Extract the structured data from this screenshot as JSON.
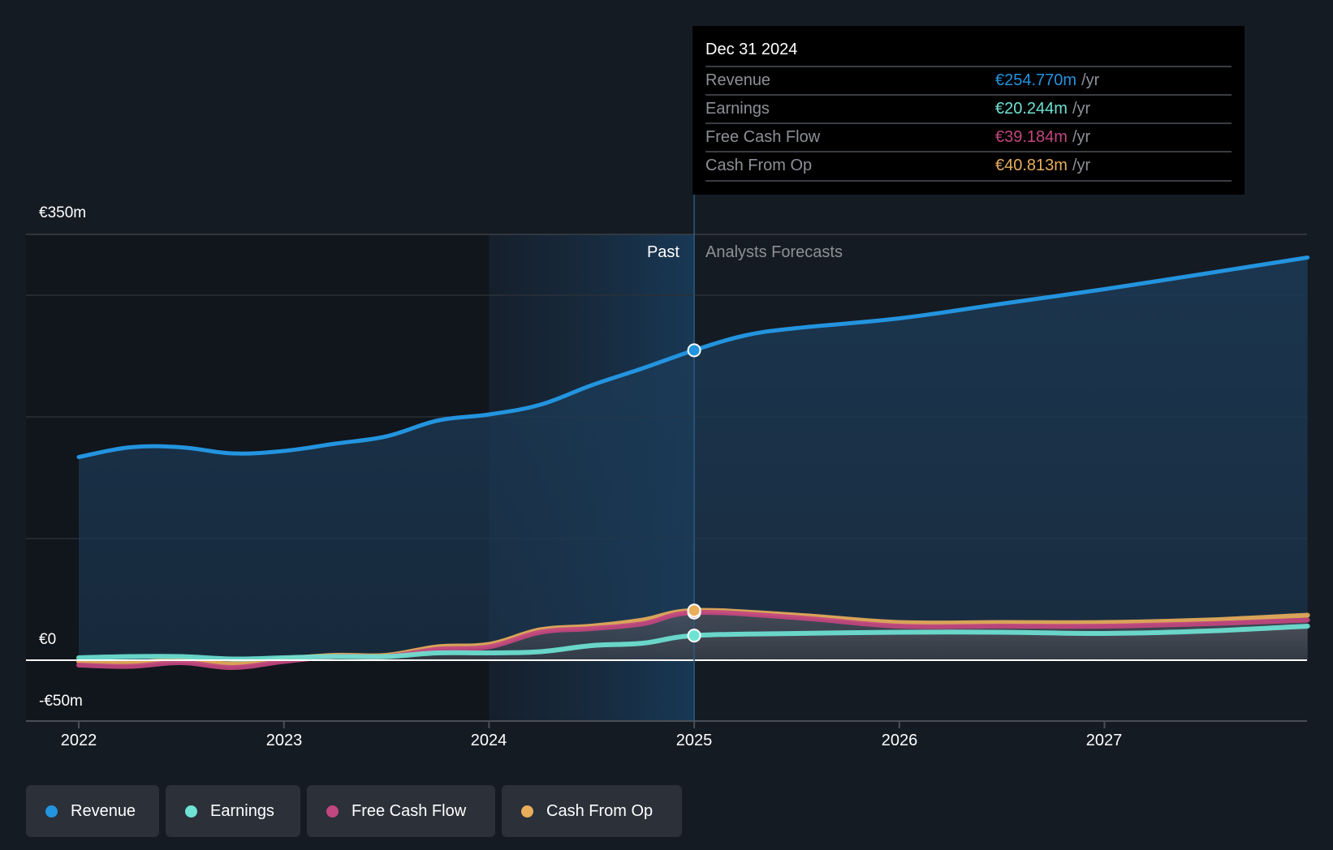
{
  "chart_data": {
    "type": "area",
    "title": "",
    "xlabel": "",
    "ylabel": "",
    "ylim": [
      -50,
      350
    ],
    "xlim": [
      2021.75,
      2027.99
    ],
    "y_ticks": [
      {
        "value": 350,
        "label": "€350m"
      },
      {
        "value": 0,
        "label": "€0"
      },
      {
        "value": -50,
        "label": "-€50m"
      }
    ],
    "gridlines": [
      350,
      300,
      200,
      100
    ],
    "x_ticks": [
      {
        "value": 2022,
        "label": "2022"
      },
      {
        "value": 2023,
        "label": "2023"
      },
      {
        "value": 2024,
        "label": "2024"
      },
      {
        "value": 2025,
        "label": "2025"
      },
      {
        "value": 2026,
        "label": "2026"
      },
      {
        "value": 2027,
        "label": "2027"
      }
    ],
    "past_forecast_split": 2025,
    "highlight_band_start": 2024,
    "region_labels": {
      "past": "Past",
      "forecast": "Analysts Forecasts"
    },
    "series": [
      {
        "name": "Revenue",
        "color": "#2394df",
        "x": [
          2022.0,
          2022.25,
          2022.5,
          2022.75,
          2023.0,
          2023.25,
          2023.5,
          2023.75,
          2024.0,
          2024.25,
          2024.5,
          2024.75,
          2025.0,
          2025.25,
          2025.5,
          2026.0,
          2026.5,
          2027.0,
          2027.5,
          2027.99
        ],
        "values": [
          167,
          175,
          175,
          170,
          172,
          178,
          184,
          197,
          202,
          210,
          226,
          240,
          254.77,
          267,
          273,
          281,
          293,
          305,
          318,
          331
        ]
      },
      {
        "name": "Earnings",
        "color": "#6ee3d4",
        "x": [
          2022.0,
          2022.25,
          2022.5,
          2022.75,
          2023.0,
          2023.25,
          2023.5,
          2023.75,
          2024.0,
          2024.25,
          2024.5,
          2024.75,
          2025.0,
          2025.5,
          2026.0,
          2026.5,
          2027.0,
          2027.5,
          2027.99
        ],
        "values": [
          2,
          3,
          3,
          1,
          2,
          3,
          3,
          6,
          6,
          7,
          12,
          14,
          20.244,
          22,
          23,
          23,
          22,
          24,
          28
        ]
      },
      {
        "name": "Free Cash Flow",
        "color": "#c2467f",
        "x": [
          2022.0,
          2022.25,
          2022.5,
          2022.75,
          2023.0,
          2023.25,
          2023.5,
          2023.75,
          2024.0,
          2024.25,
          2024.5,
          2024.75,
          2025.0,
          2025.5,
          2026.0,
          2026.5,
          2027.0,
          2027.5,
          2027.99
        ],
        "values": [
          -4,
          -5,
          -2,
          -6,
          -1,
          3,
          3,
          9,
          11,
          23,
          26,
          30,
          39.184,
          35,
          28,
          28,
          28,
          30,
          33
        ]
      },
      {
        "name": "Cash From Op",
        "color": "#e8ae5b",
        "x": [
          2022.0,
          2022.25,
          2022.5,
          2022.75,
          2023.0,
          2023.25,
          2023.5,
          2023.75,
          2024.0,
          2024.25,
          2024.5,
          2024.75,
          2025.0,
          2025.5,
          2026.0,
          2026.5,
          2027.0,
          2027.5,
          2027.99
        ],
        "values": [
          -1,
          -2,
          0,
          -3,
          1,
          4,
          4,
          11,
          13,
          25,
          28,
          33,
          40.813,
          37,
          31,
          31,
          31,
          33,
          37
        ]
      }
    ],
    "legend": {
      "placement": "bottom-left"
    }
  },
  "tooltip": {
    "date": "Dec 31 2024",
    "unit": "/yr",
    "rows": [
      {
        "label": "Revenue",
        "value": "€254.770m",
        "color": "#2394df"
      },
      {
        "label": "Earnings",
        "value": "€20.244m",
        "color": "#6ee3d4"
      },
      {
        "label": "Free Cash Flow",
        "value": "€39.184m",
        "color": "#c2467f"
      },
      {
        "label": "Cash From Op",
        "value": "€40.813m",
        "color": "#e8ae5b"
      }
    ]
  },
  "legend": [
    {
      "label": "Revenue",
      "color": "#2394df"
    },
    {
      "label": "Earnings",
      "color": "#6ee3d4"
    },
    {
      "label": "Free Cash Flow",
      "color": "#c2467f"
    },
    {
      "label": "Cash From Op",
      "color": "#e8ae5b"
    }
  ]
}
